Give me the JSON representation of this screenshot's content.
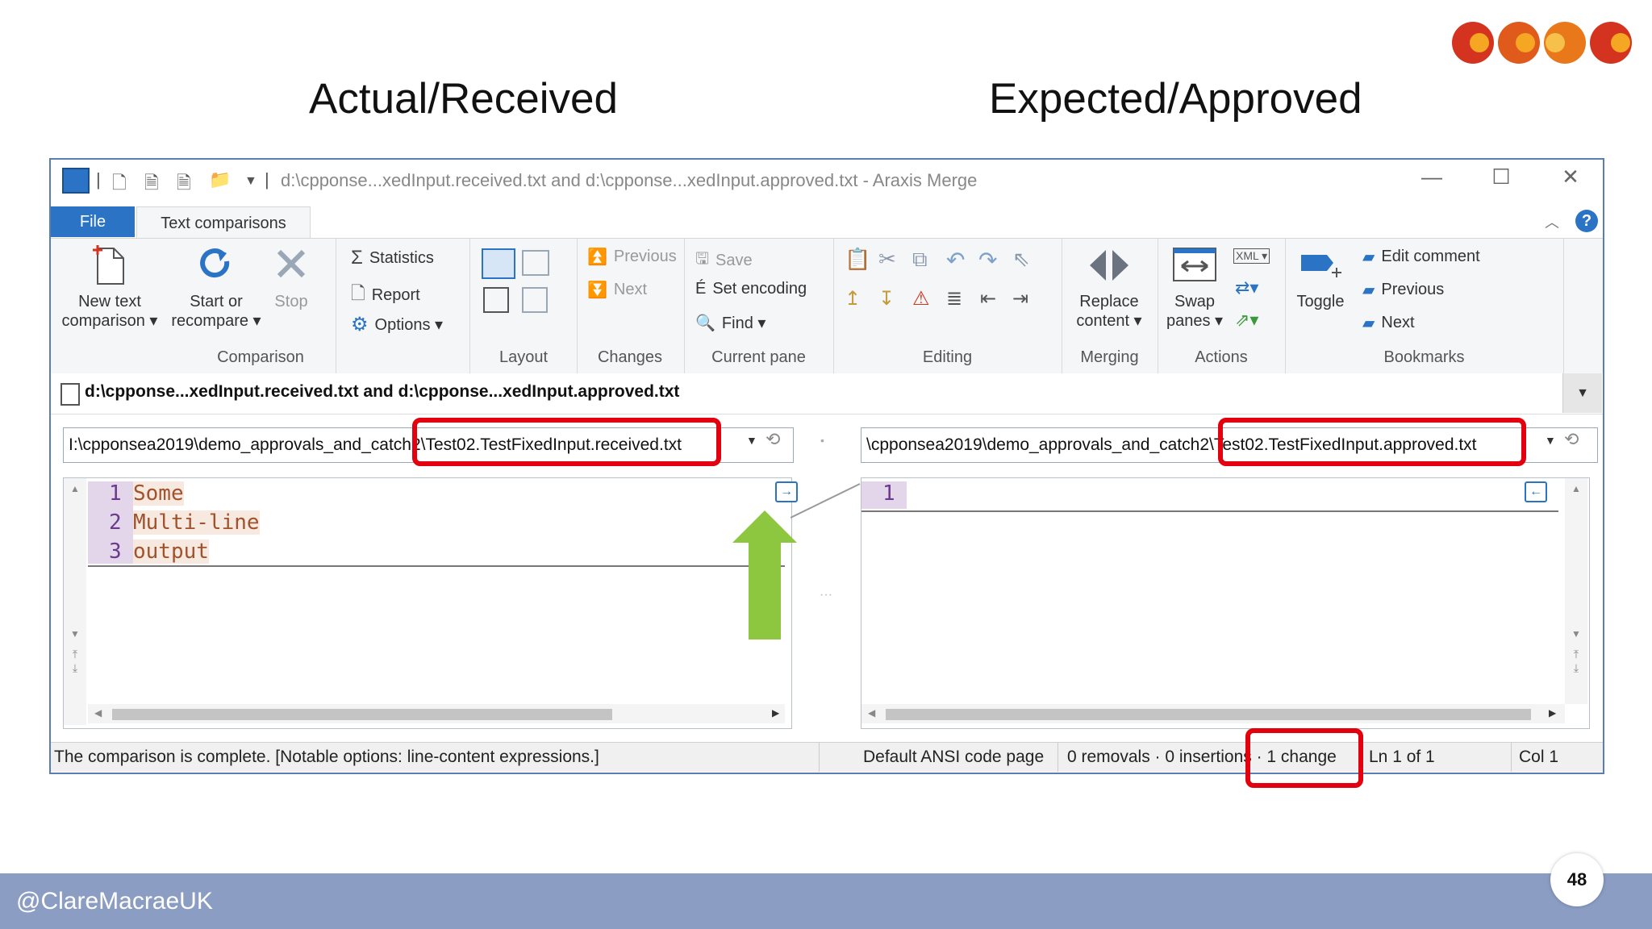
{
  "slide": {
    "heading_left": "Actual/Received",
    "heading_right": "Expected/Approved",
    "footer_handle": "@ClareMacraeUK",
    "page_number": "48"
  },
  "window": {
    "title": "d:\\cpponse...xedInput.received.txt and d:\\cpponse...xedInput.approved.txt - Araxis Merge",
    "minimize": "—",
    "maximize": "☐",
    "close": "✕"
  },
  "tabs": {
    "file": "File",
    "text_comparisons": "Text comparisons"
  },
  "ribbon": {
    "comparison": {
      "label": "Comparison",
      "new_text_1": "New text",
      "new_text_2": "comparison ▾",
      "start_1": "Start or",
      "start_2": "recompare ▾",
      "stop": "Stop",
      "statistics": "Statistics",
      "report": "Report",
      "options": "Options ▾"
    },
    "layout": {
      "label": "Layout"
    },
    "changes": {
      "label": "Changes",
      "previous": "Previous",
      "next": "Next"
    },
    "current_pane": {
      "label": "Current pane",
      "save": "Save",
      "set_encoding": "Set encoding",
      "find": "Find ▾"
    },
    "editing": {
      "label": "Editing"
    },
    "merging": {
      "label": "Merging",
      "replace_1": "Replace",
      "replace_2": "content ▾"
    },
    "actions": {
      "label": "Actions",
      "swap_1": "Swap",
      "swap_2": "panes ▾"
    },
    "bookmarks": {
      "label": "Bookmarks",
      "toggle": "Toggle",
      "edit_comment": "Edit comment",
      "previous": "Previous",
      "next": "Next"
    }
  },
  "file_header": "d:\\cpponse...xedInput.received.txt and d:\\cpponse...xedInput.approved.txt",
  "left_path": "I:\\cpponsea2019\\demo_approvals_and_catch2\\Test02.TestFixedInput.received.txt",
  "right_path": "\\cpponsea2019\\demo_approvals_and_catch2\\Test02.TestFixedInput.approved.txt",
  "left_pane": {
    "lines": [
      {
        "num": "1",
        "text": "Some"
      },
      {
        "num": "2",
        "text": "Multi-line"
      },
      {
        "num": "3",
        "text": "output"
      }
    ]
  },
  "right_pane": {
    "lines": [
      {
        "num": "1",
        "text": ""
      }
    ]
  },
  "status": {
    "message": "The comparison is complete. [Notable options: line-content expressions.]",
    "encoding": "Default ANSI code page",
    "counts": "0 removals · 0 insertions · 1 change",
    "position": "Ln 1 of 1",
    "column": "Col 1"
  },
  "colors": {
    "accent": "#2b73c4",
    "highlight_red": "#e3000f",
    "arrow_green": "#8dc63f",
    "changed_line": "#f7e9df",
    "line_number_bg": "#e3d5ea",
    "footer_bar": "#8b9dc3"
  }
}
